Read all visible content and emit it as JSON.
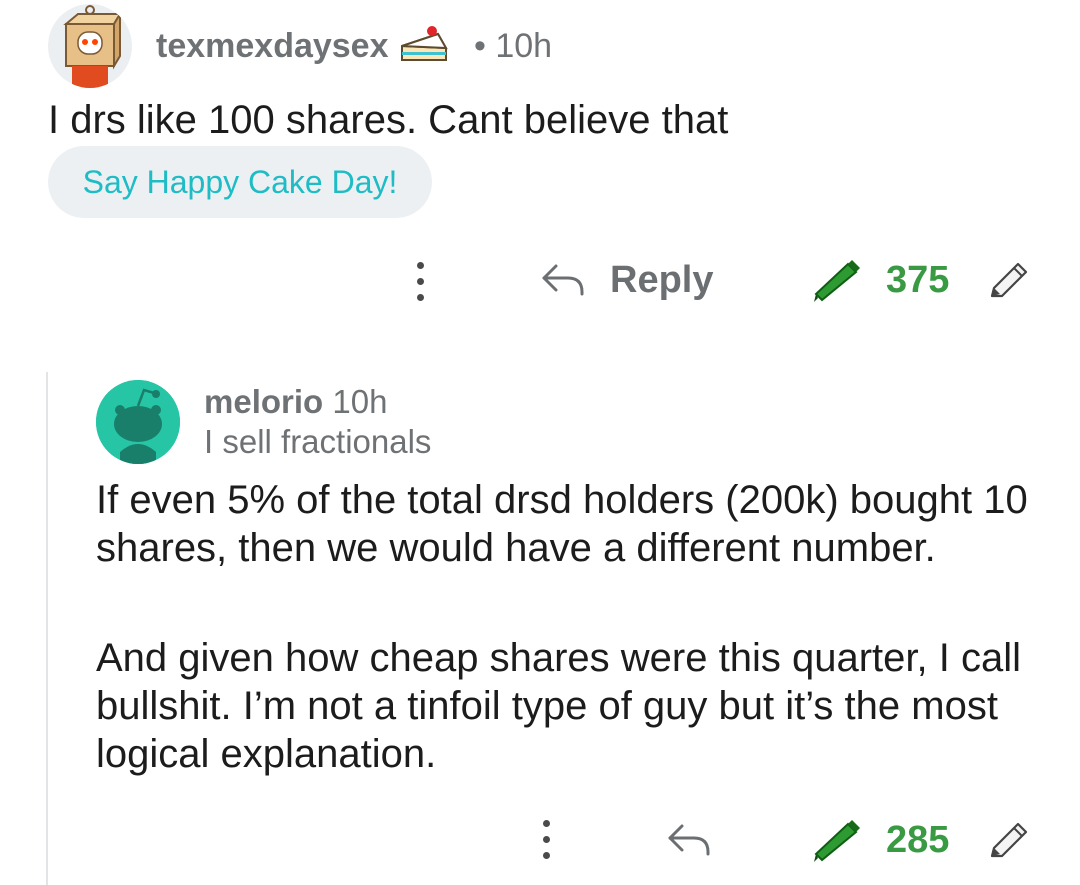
{
  "comments": [
    {
      "username": "texmexdaysex",
      "time": "• 10h",
      "body": "I drs like 100 shares. Cant believe that",
      "cake_day_button": "Say Happy Cake Day!",
      "reply_label": "Reply",
      "score": "375",
      "icons": {
        "avatar": "snoo-box-head-avatar",
        "badge": "cake-day-icon",
        "more": "more-options-icon",
        "reply": "reply-arrow-icon",
        "award": "green-crayon-icon",
        "edit": "pencil-icon"
      }
    },
    {
      "username": "melorio",
      "time": "10h",
      "flair": "I sell fractionals",
      "paragraphs": [
        "If even 5% of the total drsd holders (200k) bought 10 shares, then we would have a different number.",
        "And given how cheap shares were this quarter, I call bullshit. I’m not a tinfoil type of guy but it’s the most logical explanation."
      ],
      "score": "285",
      "icons": {
        "avatar": "default-snoo-avatar",
        "more": "more-options-icon",
        "reply": "reply-arrow-icon",
        "award": "green-crayon-icon",
        "edit": "pencil-icon"
      }
    }
  ],
  "colors": {
    "meta_gray": "#6f7275",
    "cake_button_text": "#1ebcc5",
    "score_green": "#3a9a43",
    "avatar2_bg": "#25c5a5"
  }
}
